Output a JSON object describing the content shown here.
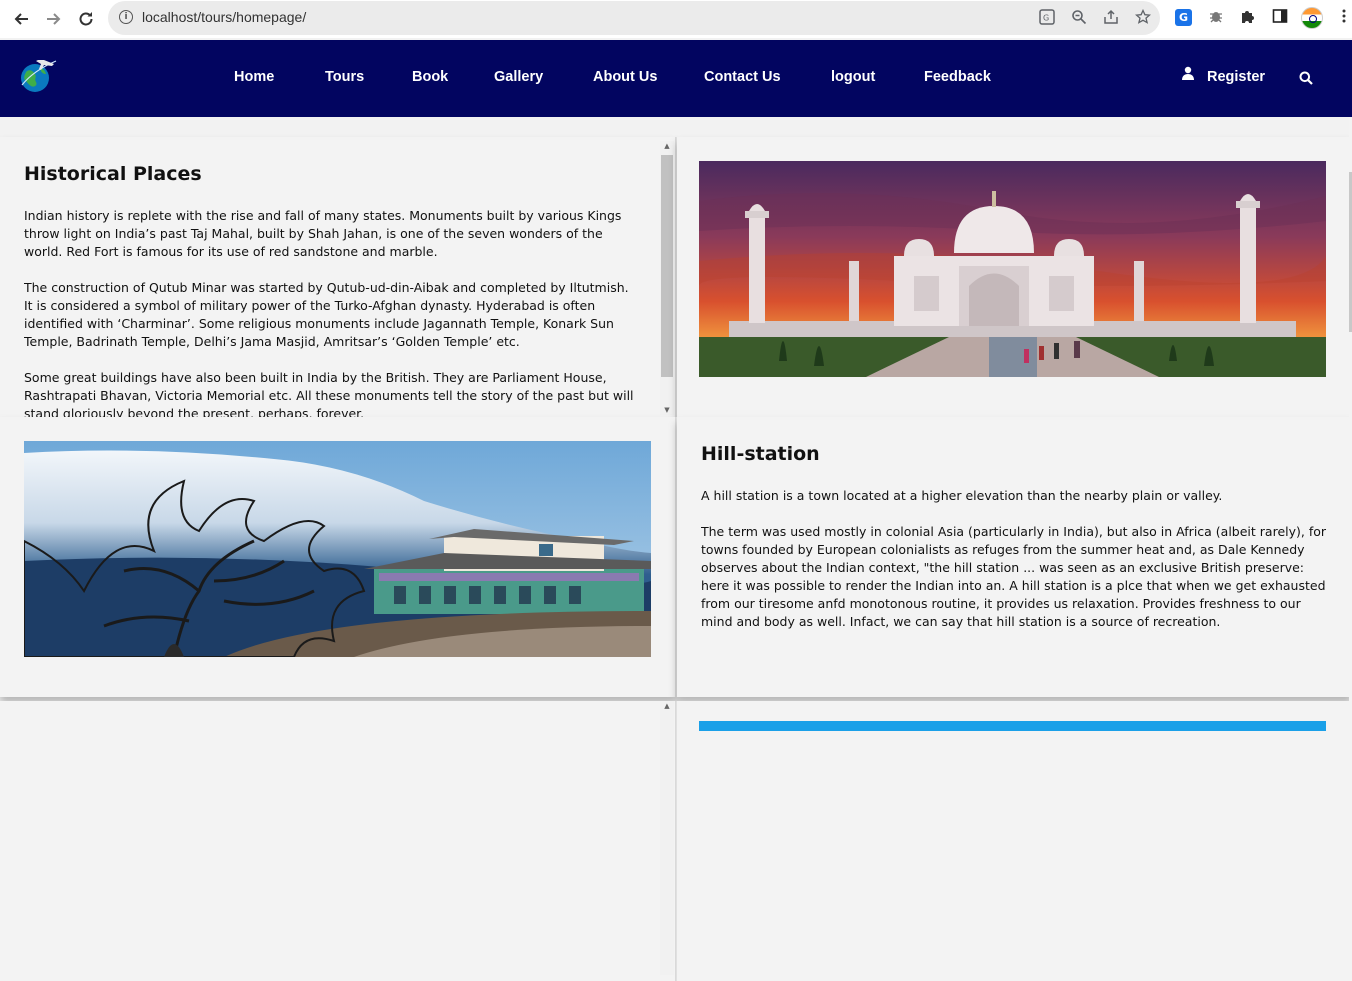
{
  "browser": {
    "url": "localhost/tours/homepage/",
    "icons": [
      "back-arrow-icon",
      "forward-arrow-icon",
      "reload-icon",
      "info-icon",
      "translate-icon",
      "zoom-icon",
      "share-icon",
      "star-icon",
      "google-translate-extension-icon",
      "bug-extension-icon",
      "puzzle-extensions-icon",
      "side-panel-icon",
      "profile-avatar",
      "kebab-menu-icon"
    ]
  },
  "nav": {
    "links": [
      "Home",
      "Tours",
      "Book",
      "Gallery",
      "About Us",
      "Contact Us",
      "logout",
      "Feedback"
    ],
    "register": "Register",
    "colors": {
      "navbar_bg": "#020560",
      "text": "#ffffff"
    }
  },
  "sections": [
    {
      "title": "Historical Places",
      "paragraphs": [
        "Indian history is replete with the rise and fall of many states. Monuments built by various Kings throw light on India’s past Taj Mahal, built by Shah Jahan, is one of the seven wonders of the world. Red Fort is famous for its use of red sandstone and marble.",
        "The construction of Qutub Minar was started by Qutub-ud-din-Aibak and completed by Iltutmish. It is considered a symbol of military power of the Turko-Afghan dynasty. Hyderabad is often identified with ‘Charminar’. Some religious monuments include Jagannath Temple, Konark Sun Temple, Badrinath Temple, Delhi’s Jama Masjid, Amritsar’s ‘Golden Temple’ etc.",
        "Some great buildings have also been built in India by the British. They are Parliament House, Rashtrapati Bhavan, Victoria Memorial etc. All these monuments tell the story of the past but will stand gloriously beyond the present, perhaps, forever."
      ]
    },
    {
      "title": "Hill-station",
      "paragraphs": [
        "A hill station is a town located at a higher elevation than the nearby plain or valley.",
        "The term was used mostly in colonial Asia (particularly in India), but also in Africa (albeit rarely), for towns founded by European colonialists as refuges from the summer heat and, as Dale Kennedy observes about the Indian context, \"the hill station ... was seen as an exclusive British preserve: here it was possible to render the Indian into an. A hill station is a plce that when we get exhausted from our tiresome anfd monotonous routine, it provides us relaxation. Provides freshness to our mind and body as well. Infact, we can say that hill station is a source of recreation."
      ]
    }
  ]
}
